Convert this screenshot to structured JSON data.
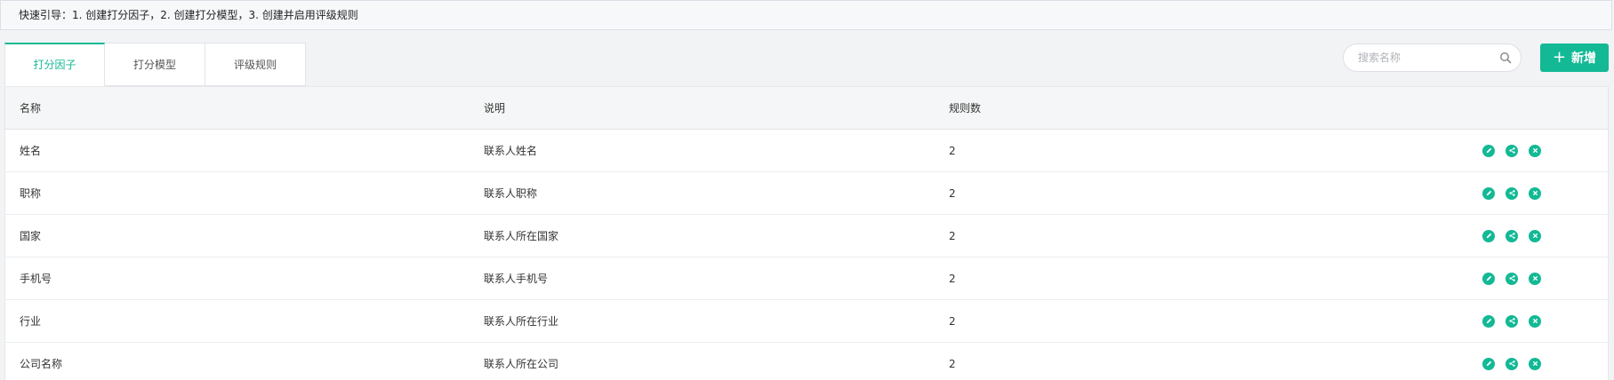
{
  "guide": {
    "text": "快速引导：1. 创建打分因子，2. 创建打分模型，3. 创建并启用评级规则"
  },
  "tabs": [
    {
      "label": "打分因子"
    },
    {
      "label": "打分模型"
    },
    {
      "label": "评级规则"
    }
  ],
  "search": {
    "placeholder": "搜索名称",
    "value": ""
  },
  "add_button": {
    "label": "新增"
  },
  "colors": {
    "accent": "#13b995"
  },
  "table": {
    "headers": {
      "name": "名称",
      "desc": "说明",
      "rules": "规则数"
    },
    "rows": [
      {
        "name": "姓名",
        "desc": "联系人姓名",
        "rules": "2"
      },
      {
        "name": "职称",
        "desc": "联系人职称",
        "rules": "2"
      },
      {
        "name": "国家",
        "desc": "联系人所在国家",
        "rules": "2"
      },
      {
        "name": "手机号",
        "desc": "联系人手机号",
        "rules": "2"
      },
      {
        "name": "行业",
        "desc": "联系人所在行业",
        "rules": "2"
      },
      {
        "name": "公司名称",
        "desc": "联系人所在公司",
        "rules": "2"
      }
    ],
    "row_actions": [
      "edit-icon",
      "share-icon",
      "delete-icon"
    ]
  }
}
